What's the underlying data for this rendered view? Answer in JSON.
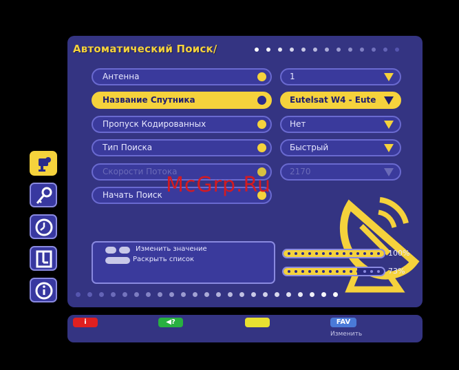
{
  "screen": {
    "title": "Автоматический Поиск/",
    "accent_color": "#f5d23c",
    "panel_color": "#343482"
  },
  "menu": [
    {
      "label": "Антенна",
      "value": "1",
      "state": "normal"
    },
    {
      "label": "Название Спутника",
      "value": "Eutelsat W4 - Eute",
      "state": "selected"
    },
    {
      "label": "Пропуск Кодированных",
      "value": "Нет",
      "state": "normal"
    },
    {
      "label": "Тип Поиска",
      "value": "Быстрый",
      "state": "normal"
    },
    {
      "label": "Скорости Потока",
      "value": "2170",
      "state": "disabled"
    },
    {
      "label": "Начать Поиск",
      "value": null,
      "state": "normal"
    }
  ],
  "side_icons": [
    {
      "icon": "satellite-dish-icon",
      "active": true
    },
    {
      "icon": "key-icon",
      "active": false
    },
    {
      "icon": "clock-icon",
      "active": false
    },
    {
      "icon": "list-icon",
      "active": false
    },
    {
      "icon": "info-icon",
      "active": false
    }
  ],
  "help": {
    "line1": "Изменить значение",
    "line2": "Раскрыть список"
  },
  "levels": [
    {
      "label": "100%",
      "value": 1.0
    },
    {
      "label": "73%",
      "value": 0.73
    }
  ],
  "color_buttons": [
    {
      "key": "i",
      "color": "#e02020"
    },
    {
      "key": "◀?",
      "color": "#28b040"
    },
    {
      "key": "",
      "color": "#e8e030"
    },
    {
      "key": "FAV",
      "color": "#4a7ad8",
      "caption": "Изменить"
    }
  ],
  "watermark": "McGrp.Ru"
}
